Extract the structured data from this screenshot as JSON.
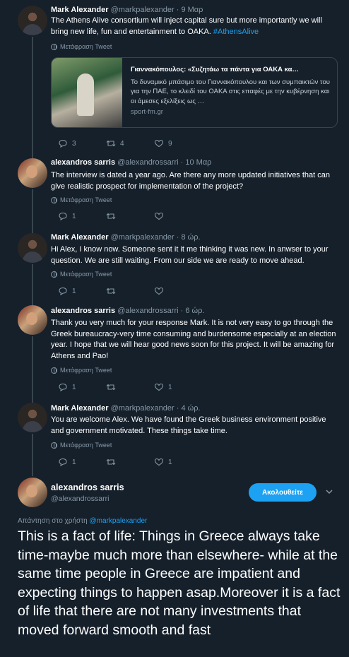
{
  "tweets": [
    {
      "name": "Mark Alexander",
      "handle": "@markpalexander",
      "time": "9 Μαρ",
      "text": "The Athens Alive consortium will inject capital sure but more importantly we will bring new life, fun and entertainment to OAKA.",
      "hashtag": "#AthensAlive",
      "translate": "Μετάφραση Tweet",
      "card": {
        "title": "Γιαννακόπουλος: «Συζητάω τα πάντα για ΟΑΚΑ κα…",
        "description": "Το δυναμικό μπάσιμο του Γιαννακόπουλου και των συμπαικτών του για την ΠΑΕ, το κλειδί του ΟΑΚΑ στις επαφές με την κυβέρνηση και οι άμεσες εξελίξεις ως …",
        "domain": "sport-fm.gr"
      },
      "replies": "3",
      "retweets": "4",
      "likes": "9"
    },
    {
      "name": "alexandros sarris",
      "handle": "@alexandrossarri",
      "time": "10 Μαρ",
      "text": "The interview is dated a year ago. Are there any more updated initiatives that can give realistic prospect for implementation of the project?",
      "translate": "Μετάφραση Tweet",
      "replies": "1",
      "retweets": "",
      "likes": ""
    },
    {
      "name": "Mark Alexander",
      "handle": "@markpalexander",
      "time": "8 ώρ.",
      "text": "Hi Alex, I know now. Someone sent it it me thinking it was new. In anwser to your question. We are still waiting. From our side we are ready to move ahead.",
      "translate": "Μετάφραση Tweet",
      "replies": "1",
      "retweets": "",
      "likes": ""
    },
    {
      "name": "alexandros sarris",
      "handle": "@alexandrossarri",
      "time": "6 ώρ.",
      "text": "Thank you very much for your response Mark. It is not very easy to go through the Greek bureaucracy-very time consuming and burdensome especially at an election year. I hope that we will hear good news soon for this project. It will be amazing for Athens and Pao!",
      "translate": "Μετάφραση Tweet",
      "replies": "1",
      "retweets": "",
      "likes": "1"
    },
    {
      "name": "Mark Alexander",
      "handle": "@markpalexander",
      "time": "4 ώρ.",
      "text": "You are welcome Alex. We have found the Greek business environment positive and government motivated. These things take time.",
      "translate": "Μετάφραση Tweet",
      "replies": "1",
      "retweets": "",
      "likes": "1"
    }
  ],
  "main_tweet": {
    "name": "alexandros sarris",
    "handle": "@alexandrossarri",
    "follow_label": "Ακολουθείτε",
    "reply_prefix": "Απάντηση στο χρήστη",
    "reply_mention": "@markpalexander",
    "text": "This is a fact of life: Things in Greece always take time-maybe much more than elsewhere- while at the same time people in Greece are impatient and expecting things to happen asap.Moreover it is a fact of life that there are not many investments that moved forward smooth and fast"
  },
  "separator": "·",
  "colors": {
    "background": "#15202b",
    "accent": "#1da1f2",
    "muted": "#8899a6",
    "border": "#38444d"
  }
}
